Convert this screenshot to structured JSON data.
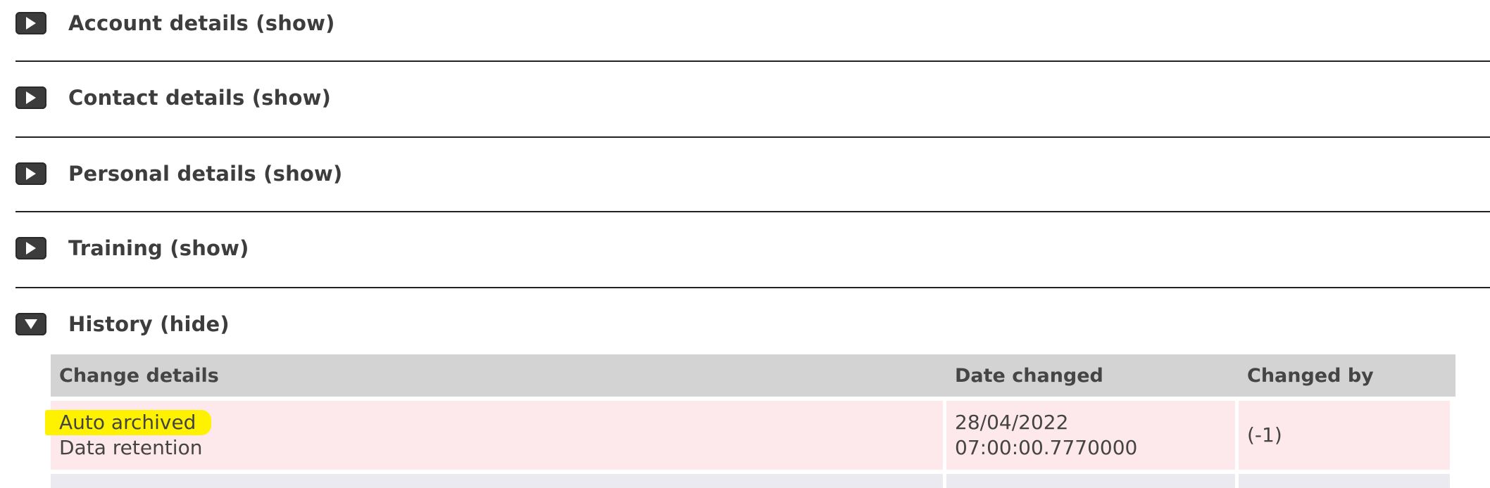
{
  "sections": [
    {
      "key": "account",
      "title": "Account details (show)",
      "expanded": false
    },
    {
      "key": "contact",
      "title": "Contact details (show)",
      "expanded": false
    },
    {
      "key": "personal",
      "title": "Personal details (show)",
      "expanded": false
    },
    {
      "key": "training",
      "title": "Training (show)",
      "expanded": false
    },
    {
      "key": "history",
      "title": "History (hide)",
      "expanded": true
    }
  ],
  "history": {
    "columns": [
      "Change details",
      "Date changed",
      "Changed by"
    ],
    "rows": [
      {
        "change_title": "Auto archived",
        "change_detail": "Data retention",
        "date": "28/04/2022",
        "time": "07:00:00.7770000",
        "changed_by": "(-1)"
      }
    ]
  },
  "colors": {
    "header_bg": "#d3d3d3",
    "row_bg": "#fde8ec",
    "highlight": "#fff200",
    "icon_bg": "#3c3c3c"
  },
  "icons": {
    "collapsed": "play-triangle-icon",
    "expanded": "down-triangle-icon"
  }
}
